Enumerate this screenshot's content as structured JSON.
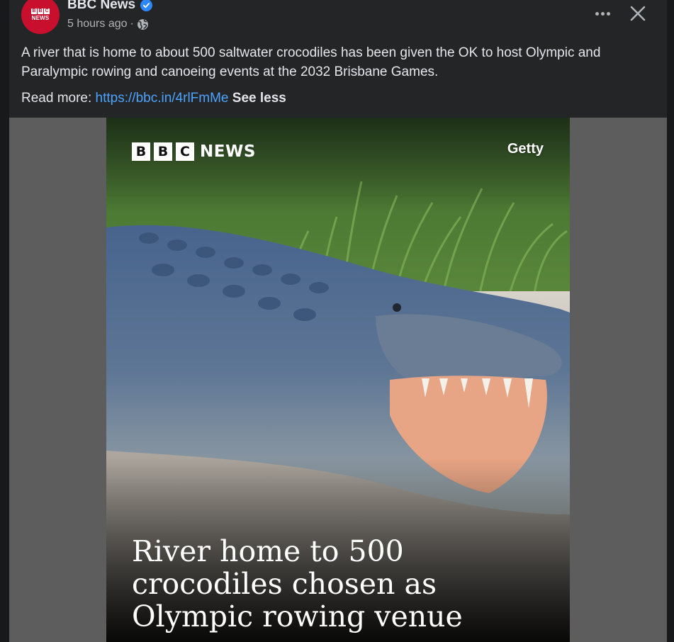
{
  "colors": {
    "background": "#18191a",
    "card": "#242526",
    "text_primary": "#e4e6eb",
    "text_secondary": "#b0b3b8",
    "link": "#4da3ff",
    "verified": "#2d88ff",
    "bbc_red": "#c8102e"
  },
  "post": {
    "avatar": {
      "blocks": [
        "B",
        "B",
        "C"
      ],
      "sub_label": "NEWS"
    },
    "page_name": "BBC News",
    "verified_icon": "verified-badge-icon",
    "timestamp": "5 hours ago",
    "separator": "·",
    "audience_icon": "globe-icon",
    "more_icon": "more-dots-icon",
    "close_icon": "close-icon",
    "text": "A river that is home to about 500 saltwater crocodiles has been given the OK to host Olympic and Paralympic rowing and canoeing events at the 2032 Brisbane Games.",
    "read_more_prefix": "Read more: ",
    "link_text": "https://bbc.in/4rlFmMe",
    "see_less": "See less"
  },
  "media": {
    "logo_letters": [
      "B",
      "B",
      "C"
    ],
    "logo_word": "NEWS",
    "credit": "Getty",
    "headline": "River home to 500 crocodiles chosen as Olympic rowing venue"
  }
}
